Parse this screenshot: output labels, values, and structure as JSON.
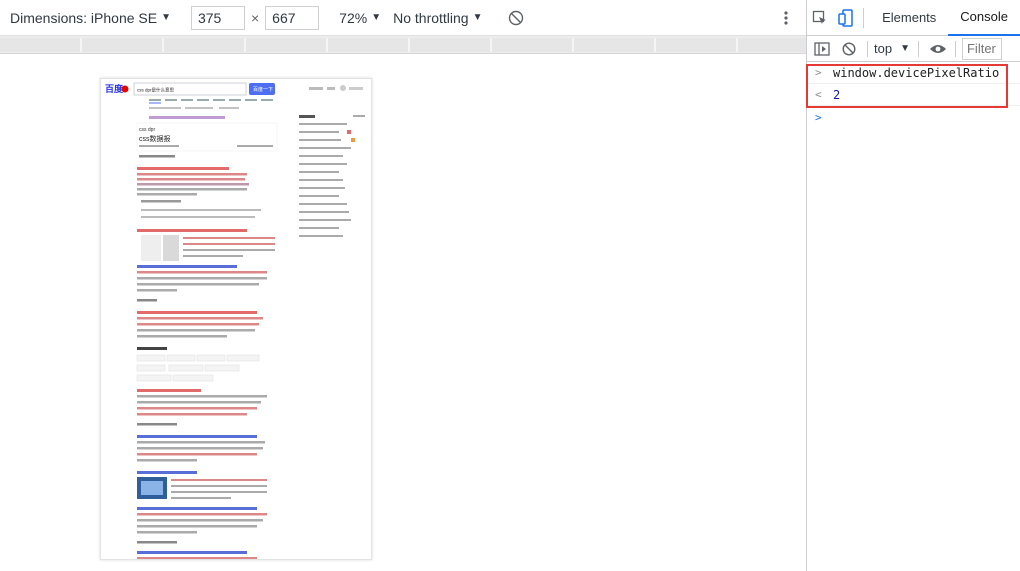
{
  "device_toolbar": {
    "dimensions_label": "Dimensions: iPhone SE",
    "width": "375",
    "times": "×",
    "height": "667",
    "zoom": "72%",
    "throttling": "No throttling"
  },
  "devtools": {
    "tabs": [
      "Elements",
      "Console"
    ],
    "active_tab": "Console",
    "context": "top",
    "filter_placeholder": "Filter"
  },
  "console": {
    "lines": [
      {
        "prompt": ">",
        "text": "window.devicePixelRatio"
      },
      {
        "prompt": "<",
        "text": "2"
      },
      {
        "prompt": ">",
        "text": ""
      }
    ]
  },
  "mini_page": {
    "logo": "百度",
    "search_query": "css dpr是什么意思",
    "search_button": "百度一下",
    "result_title": "css dpr",
    "result_subtitle": "css数据报"
  },
  "colors": {
    "accent": "#1a73e8",
    "highlight_box": "#e53935",
    "baidu_blue": "#2932e1",
    "baidu_red": "#e10601"
  }
}
